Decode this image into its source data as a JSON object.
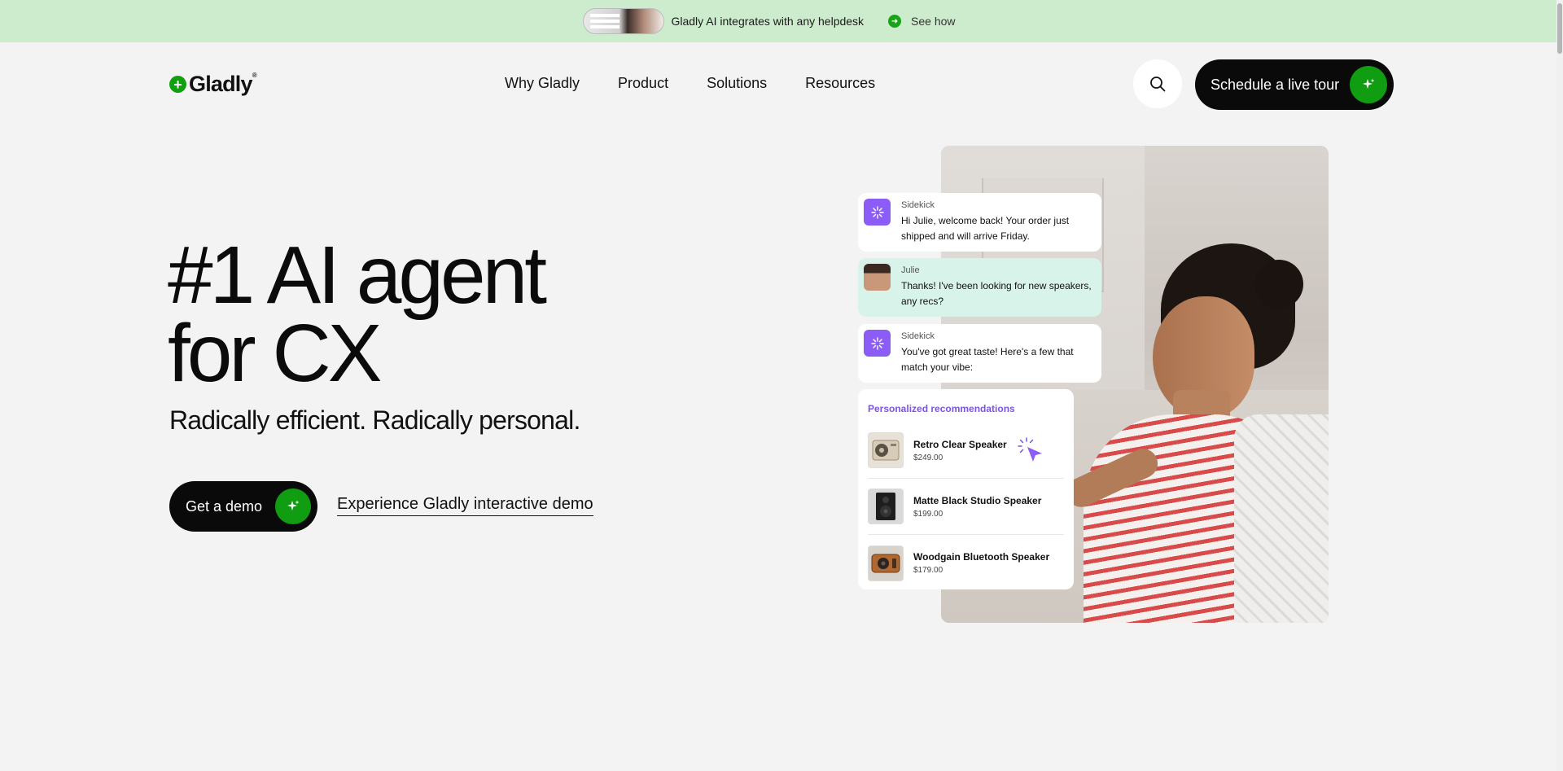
{
  "announcement": {
    "text": "Gladly AI integrates with any helpdesk",
    "link": "See how"
  },
  "header": {
    "logo": "Gladly",
    "logo_reg": "®",
    "nav": [
      "Why Gladly",
      "Product",
      "Solutions",
      "Resources"
    ],
    "search_icon": "search-icon",
    "cta": "Schedule a live tour"
  },
  "hero": {
    "title_line1": "#1 AI agent",
    "title_line2": "for CX",
    "subtitle": "Radically efficient. Radically personal.",
    "primary_cta": "Get a demo",
    "secondary_cta": "Experience Gladly interactive demo"
  },
  "chat": {
    "messages": [
      {
        "name": "Sidekick",
        "text": "Hi Julie, welcome back! Your order just shipped and will arrive Friday."
      },
      {
        "name": "Julie",
        "text": "Thanks! I've been looking for new speakers, any recs?"
      },
      {
        "name": "Sidekick",
        "text": "You've got great taste! Here's a few that match your vibe:"
      }
    ],
    "recommendations": {
      "title": "Personalized recommendations",
      "items": [
        {
          "name": "Retro Clear Speaker",
          "price": "$249.00"
        },
        {
          "name": "Matte Black Studio Speaker",
          "price": "$199.00"
        },
        {
          "name": "Woodgain Bluetooth Speaker",
          "price": "$179.00"
        }
      ]
    }
  },
  "colors": {
    "brand_green": "#119d11",
    "announce_bg": "#cdeccd",
    "accent_purple": "#8b5cf6",
    "page_bg": "#f3f3f3"
  }
}
